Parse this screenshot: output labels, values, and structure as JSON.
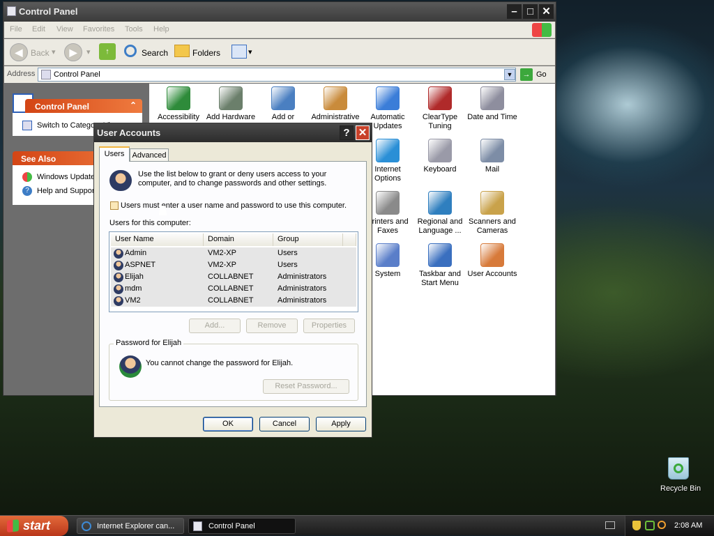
{
  "control_panel": {
    "title": "Control Panel",
    "menu": [
      "File",
      "Edit",
      "View",
      "Favorites",
      "Tools",
      "Help"
    ],
    "toolbar": {
      "back": "Back",
      "search": "Search",
      "folders": "Folders"
    },
    "address": {
      "label": "Address",
      "value": "Control Panel",
      "go": "Go"
    },
    "sidebar": {
      "panel_title": "Control Panel",
      "switch_link": "Switch to Category View",
      "see_also_title": "See Also",
      "see_also": [
        "Windows Update",
        "Help and Support"
      ]
    },
    "icons": [
      {
        "label": "Accessibility Options",
        "color": "#2e8b3a"
      },
      {
        "label": "Add Hardware",
        "color": "#6b7f6b"
      },
      {
        "label": "Add or Remove Programs",
        "color": "#4a7fc1"
      },
      {
        "label": "Administrative Tools",
        "color": "#c98b3b"
      },
      {
        "label": "Automatic Updates",
        "color": "#3b7dd8"
      },
      {
        "label": "ClearType Tuning",
        "color": "#b02a2a"
      },
      {
        "label": "Date and Time",
        "color": "#8e8e9e"
      },
      {
        "label": "Internet Options",
        "color": "#2a8fd6"
      },
      {
        "label": "Keyboard",
        "color": "#9a9aa8"
      },
      {
        "label": "Mail",
        "color": "#7d8da6"
      },
      {
        "label": "Printers and Faxes",
        "color": "#8a8a8a"
      },
      {
        "label": "Regional and Language ...",
        "color": "#2f7fbf"
      },
      {
        "label": "Scanners and Cameras",
        "color": "#c9a24a"
      },
      {
        "label": "System",
        "color": "#5a7ec9"
      },
      {
        "label": "Taskbar and Start Menu",
        "color": "#3a6fbf"
      },
      {
        "label": "User Accounts",
        "color": "#d77a3a"
      }
    ]
  },
  "dialog": {
    "title": "User Accounts",
    "tabs": [
      "Users",
      "Advanced"
    ],
    "intro": "Use the list below to grant or deny users access to your computer, and to change passwords and other settings.",
    "checkbox_label": "Users must enter a user name and password to use this computer.",
    "list_label": "Users for this computer:",
    "columns": [
      "User Name",
      "Domain",
      "Group"
    ],
    "users": [
      {
        "name": "Admin",
        "domain": "VM2-XP",
        "group": "Users"
      },
      {
        "name": "ASPNET",
        "domain": "VM2-XP",
        "group": "Users"
      },
      {
        "name": "Elijah",
        "domain": "COLLABNET",
        "group": "Administrators"
      },
      {
        "name": "mdm",
        "domain": "COLLABNET",
        "group": "Administrators"
      },
      {
        "name": "VM2",
        "domain": "COLLABNET",
        "group": "Administrators"
      }
    ],
    "buttons": {
      "add": "Add...",
      "remove": "Remove",
      "properties": "Properties"
    },
    "password_group_title": "Password for Elijah",
    "password_message": "You cannot change the password for Elijah.",
    "reset_password": "Reset Password...",
    "ok": "OK",
    "cancel": "Cancel",
    "apply": "Apply"
  },
  "desktop": {
    "recycle_bin": "Recycle Bin"
  },
  "taskbar": {
    "start": "start",
    "tasks": [
      "Internet Explorer can...",
      "Control Panel"
    ],
    "clock": "2:08 AM"
  }
}
